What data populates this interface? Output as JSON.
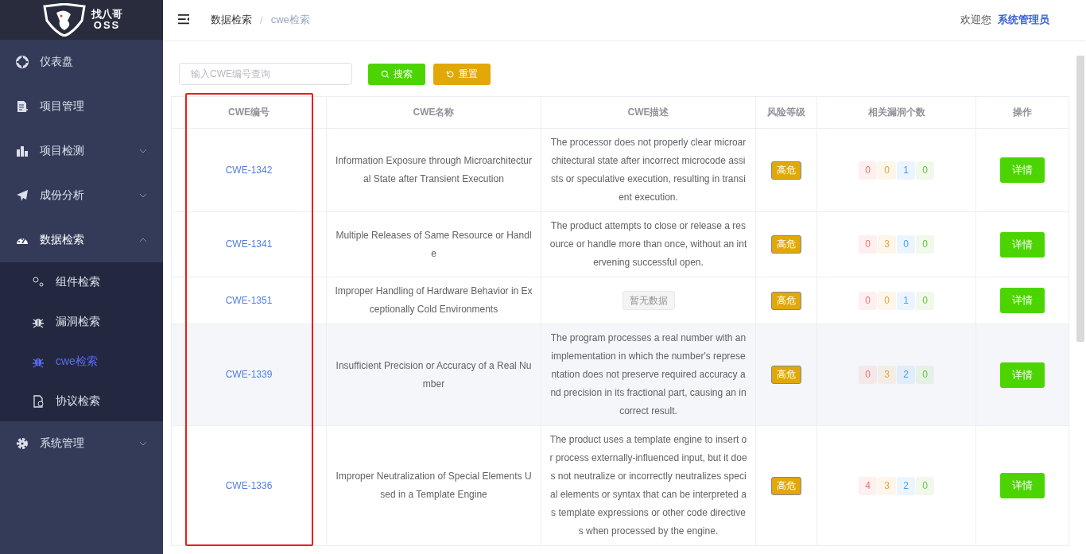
{
  "sidebar": {
    "logo": {
      "title": "找八哥",
      "subtitle": "OSS"
    },
    "items": [
      {
        "label": "仪表盘",
        "kind": "target",
        "selected": false
      },
      {
        "label": "项目管理",
        "kind": "doc",
        "selected": false
      },
      {
        "label": "项目检测",
        "kind": "bars",
        "selected": false,
        "expanded": false
      },
      {
        "label": "成份分析",
        "kind": "plane",
        "selected": false,
        "expanded": false
      },
      {
        "label": "数据检索",
        "kind": "gauge",
        "selected": false,
        "expanded": true,
        "children": [
          {
            "label": "组件检索",
            "kind": "nodes",
            "selected": false
          },
          {
            "label": "漏洞检索",
            "kind": "bug",
            "selected": false
          },
          {
            "label": "cwe检索",
            "kind": "bug",
            "selected": true
          },
          {
            "label": "协议检索",
            "kind": "file",
            "selected": false
          }
        ]
      },
      {
        "label": "系统管理",
        "kind": "gear",
        "selected": false,
        "expanded": false
      }
    ]
  },
  "header": {
    "separator": "/",
    "breadcrumb": [
      {
        "label": "数据检索",
        "current": false
      },
      {
        "label": "cwe检索",
        "current": true
      }
    ],
    "welcome": "欢迎您",
    "user": "系统管理员"
  },
  "search": {
    "placeholder": "输入CWE编号查询",
    "buttons": [
      {
        "label": "搜索",
        "kind": "search"
      },
      {
        "label": "重置",
        "kind": "reset"
      }
    ]
  },
  "table": {
    "columns": [
      {
        "label": "CWE编号",
        "highlighted": true
      },
      {
        "label": "CWE名称",
        "highlighted": false
      },
      {
        "label": "CWE描述",
        "highlighted": false
      },
      {
        "label": "风险等级",
        "highlighted": false
      },
      {
        "label": "相关漏洞个数",
        "highlighted": false
      },
      {
        "label": "操作",
        "highlighted": false
      }
    ],
    "rows": [
      {
        "id": "CWE-1342",
        "name": "Information Exposure through Microarchitectural State after Transient Execution",
        "description": "The processor does not properly clear microarchitectural state after incorrect microcode assists or speculative execution, resulting in transient execution.",
        "risk": "高危",
        "counts": [
          {
            "value": "0",
            "color": "#f56c6c"
          },
          {
            "value": "0",
            "color": "#e6a23c"
          },
          {
            "value": "1",
            "color": "#409eff"
          },
          {
            "value": "0",
            "color": "#67c23a"
          }
        ],
        "action": "详情",
        "hovered": false
      },
      {
        "id": "CWE-1341",
        "name": "Multiple Releases of Same Resource or Handle",
        "description": "The product attempts to close or release a resource or handle more than once, without an intervening successful open.",
        "risk": "高危",
        "counts": [
          {
            "value": "0",
            "color": "#f56c6c"
          },
          {
            "value": "3",
            "color": "#e6a23c"
          },
          {
            "value": "0",
            "color": "#409eff"
          },
          {
            "value": "0",
            "color": "#67c23a"
          }
        ],
        "action": "详情",
        "hovered": false
      },
      {
        "id": "CWE-1351",
        "name": "Improper Handling of Hardware Behavior in Exceptionally Cold Environments",
        "empty_description": "暂无数据",
        "risk": "高危",
        "counts": [
          {
            "value": "0",
            "color": "#f56c6c"
          },
          {
            "value": "0",
            "color": "#e6a23c"
          },
          {
            "value": "1",
            "color": "#409eff"
          },
          {
            "value": "0",
            "color": "#67c23a"
          }
        ],
        "action": "详情",
        "hovered": false
      },
      {
        "id": "CWE-1339",
        "name": "Insufficient Precision or Accuracy of a Real Number",
        "description": "The program processes a real number with an implementation in which the number's representation does not preserve required accuracy and precision in its fractional part, causing an incorrect result.",
        "risk": "高危",
        "counts": [
          {
            "value": "0",
            "color": "#f56c6c"
          },
          {
            "value": "3",
            "color": "#e6a23c"
          },
          {
            "value": "2",
            "color": "#409eff"
          },
          {
            "value": "0",
            "color": "#67c23a"
          }
        ],
        "action": "详情",
        "hovered": true
      },
      {
        "id": "CWE-1336",
        "name": "Improper Neutralization of Special Elements Used in a Template Engine",
        "description": "The product uses a template engine to insert or process externally-influenced input, but it does not neutralize or incorrectly neutralizes special elements or syntax that can be interpreted as template expressions or other code directives when processed by the engine.",
        "risk": "高危",
        "counts": [
          {
            "value": "4",
            "color": "#f56c6c"
          },
          {
            "value": "3",
            "color": "#e6a23c"
          },
          {
            "value": "2",
            "color": "#409eff"
          },
          {
            "value": "0",
            "color": "#67c23a"
          }
        ],
        "action": "详情",
        "hovered": false
      }
    ]
  }
}
